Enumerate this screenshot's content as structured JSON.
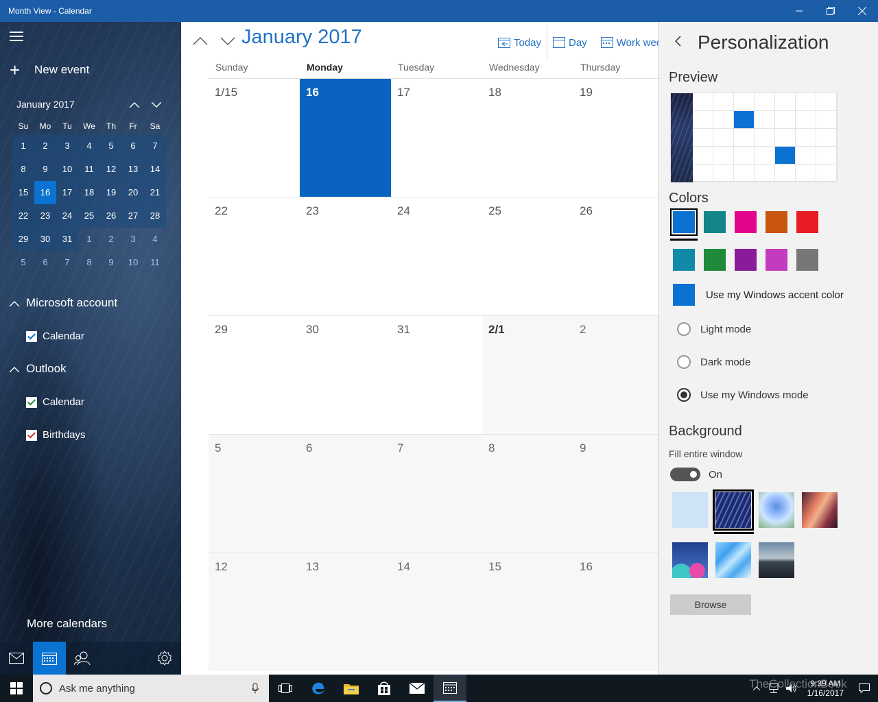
{
  "window": {
    "title": "Month View - Calendar",
    "minimize": "—",
    "restore": "❐",
    "close": "✕"
  },
  "sidebar": {
    "new_event": "New event",
    "mini_month": "January 2017",
    "dow": [
      "Su",
      "Mo",
      "Tu",
      "We",
      "Th",
      "Fr",
      "Sa"
    ],
    "weeks": [
      [
        "1",
        "2",
        "3",
        "4",
        "5",
        "6",
        "7"
      ],
      [
        "8",
        "9",
        "10",
        "11",
        "12",
        "13",
        "14"
      ],
      [
        "15",
        "16",
        "17",
        "18",
        "19",
        "20",
        "21"
      ],
      [
        "22",
        "23",
        "24",
        "25",
        "26",
        "27",
        "28"
      ],
      [
        "29",
        "30",
        "31",
        "1",
        "2",
        "3",
        "4"
      ],
      [
        "5",
        "6",
        "7",
        "8",
        "9",
        "10",
        "11"
      ]
    ],
    "accounts": [
      {
        "name": "Microsoft account",
        "calendars": [
          {
            "label": "Calendar",
            "color": "#0a72d1"
          }
        ]
      },
      {
        "name": "Outlook",
        "calendars": [
          {
            "label": "Calendar",
            "color": "#1f8a3a"
          },
          {
            "label": "Birthdays",
            "color": "#c83232"
          }
        ]
      }
    ],
    "more_calendars": "More calendars"
  },
  "main": {
    "month_title": "January 2017",
    "toolbar": {
      "today": "Today",
      "day": "Day",
      "work_week": "Work week"
    },
    "dow": [
      "Sunday",
      "Monday",
      "Tuesday",
      "Wednesday",
      "Thursday"
    ],
    "weeks": [
      [
        "1/15",
        "16",
        "17",
        "18",
        "19"
      ],
      [
        "22",
        "23",
        "24",
        "25",
        "26"
      ],
      [
        "29",
        "30",
        "31",
        "2/1",
        "2"
      ],
      [
        "5",
        "6",
        "7",
        "8",
        "9"
      ],
      [
        "12",
        "13",
        "14",
        "15",
        "16"
      ]
    ]
  },
  "personalization": {
    "title": "Personalization",
    "preview_label": "Preview",
    "colors_label": "Colors",
    "colors": [
      "#0a72d1",
      "#14858a",
      "#e3068c",
      "#c8560e",
      "#e81c24",
      "#0f8aa8",
      "#1f8a3a",
      "#8a1c9c",
      "#c33bbf",
      "#777777"
    ],
    "accent_label": "Use my Windows accent color",
    "modes": [
      "Light mode",
      "Dark mode",
      "Use my Windows mode"
    ],
    "selected_mode": 2,
    "background_label": "Background",
    "fill_label": "Fill entire window",
    "toggle_state": "On",
    "browse": "Browse"
  },
  "taskbar": {
    "search_placeholder": "Ask me anything",
    "time": "9:39 AM",
    "date": "1/16/2017"
  },
  "watermark": "TheCollectionBook"
}
